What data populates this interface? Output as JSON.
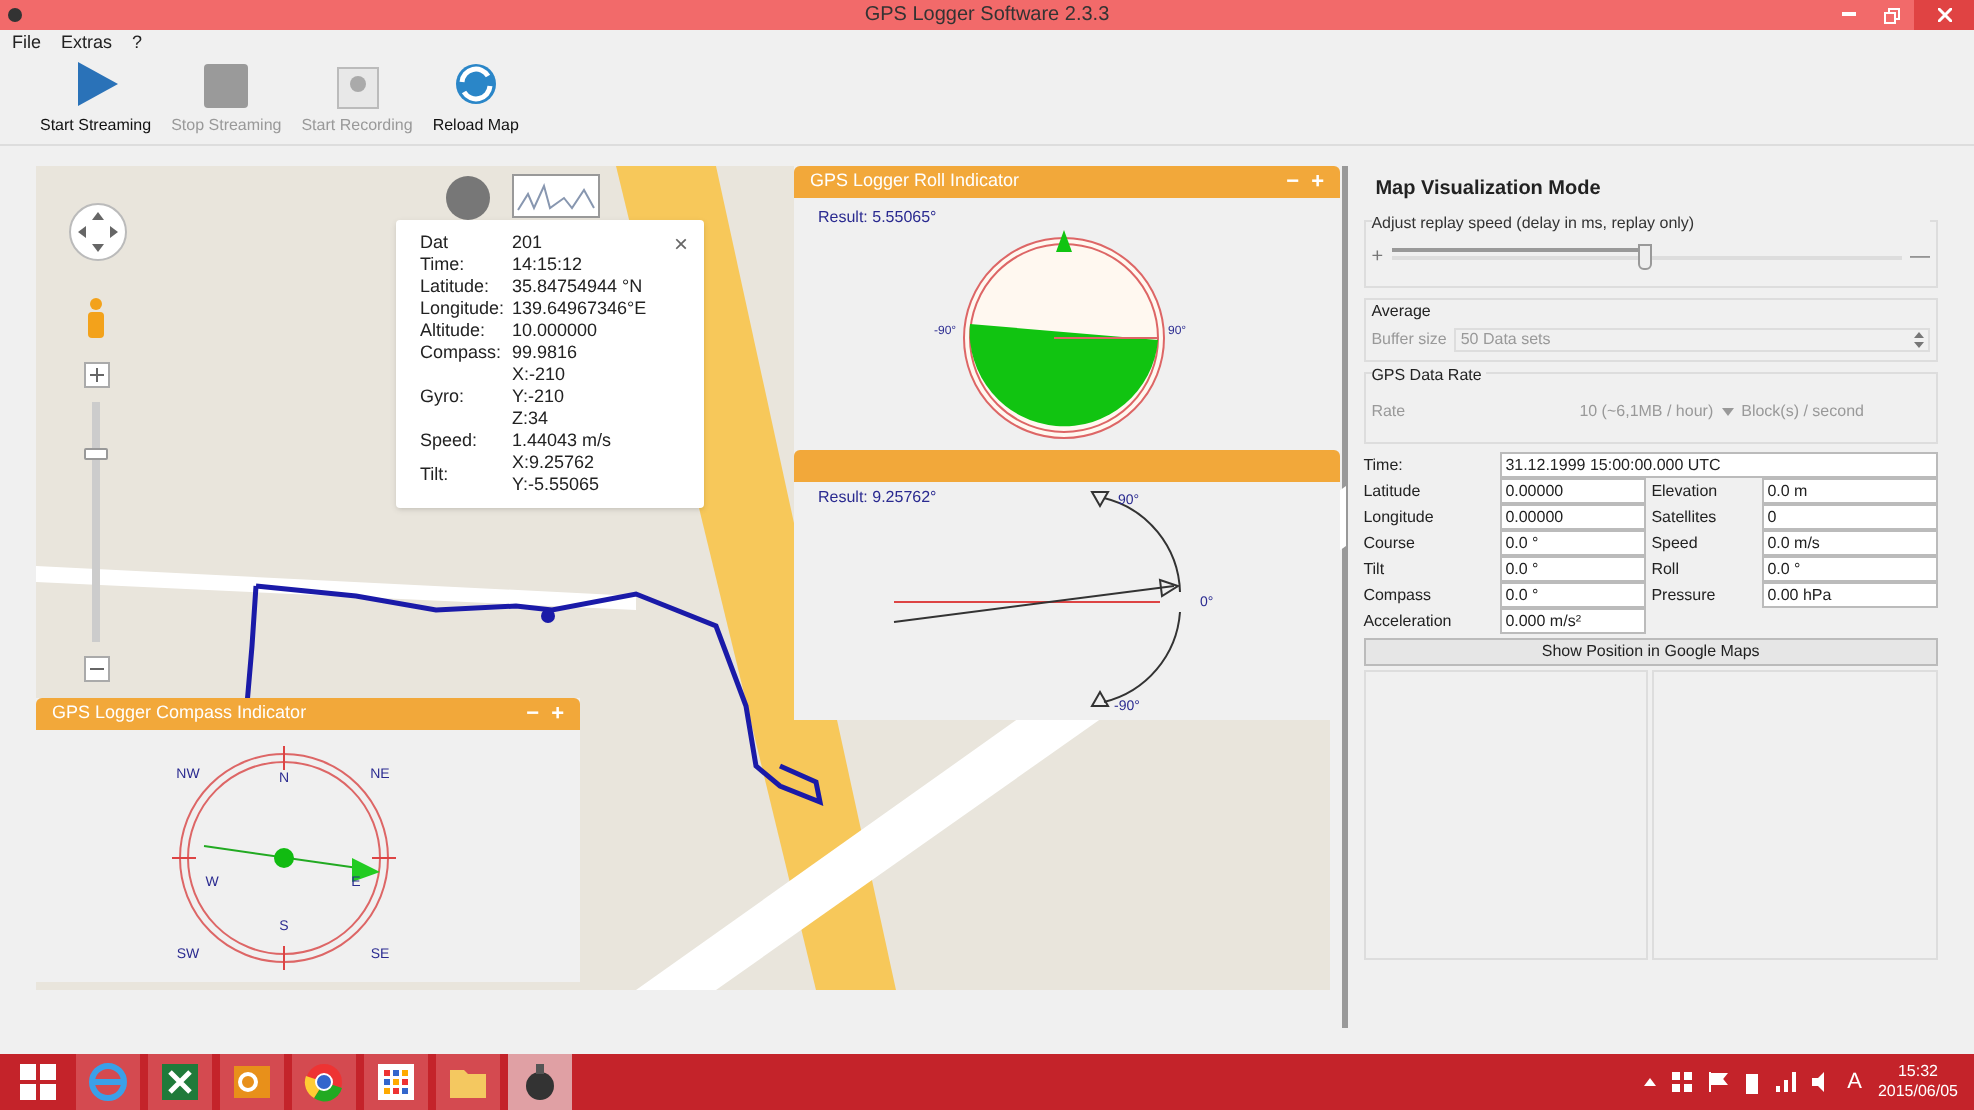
{
  "window": {
    "title": "GPS Logger Software 2.3.3"
  },
  "menu": [
    "File",
    "Extras",
    "?"
  ],
  "toolbar": [
    {
      "kind": "play",
      "label": "Start Streaming",
      "disabled": false
    },
    {
      "kind": "stop",
      "label": "Stop Streaming",
      "disabled": true
    },
    {
      "kind": "record",
      "label": "Start Recording",
      "disabled": true
    },
    {
      "kind": "reload",
      "label": "Reload Map",
      "disabled": false
    }
  ],
  "popup": {
    "rows": [
      {
        "label": "Dat",
        "lines": [
          "201"
        ]
      },
      {
        "label": "Time:",
        "lines": [
          "14:15:12"
        ]
      },
      {
        "label": "Latitude:",
        "lines": [
          "35.84754944 °N"
        ]
      },
      {
        "label": "Longitude:",
        "lines": [
          "139.64967346°E"
        ]
      },
      {
        "label": "Altitude:",
        "lines": [
          "10.000000"
        ]
      },
      {
        "label": "Compass:",
        "lines": [
          "99.9816"
        ]
      },
      {
        "label": "Gyro:",
        "lines": [
          "X:-210",
          "Y:-210",
          "Z:34"
        ]
      },
      {
        "label": "Speed:",
        "lines": [
          "1.44043 m/s"
        ]
      },
      {
        "label": "Tilt:",
        "lines": [
          "X:9.25762",
          "Y:-5.55065"
        ]
      }
    ],
    "close": "×"
  },
  "map_zoom": {
    "level": 0.8
  },
  "roll_panel": {
    "title": "GPS Logger Roll Indicator",
    "result": "Result: 5.55065°",
    "left": "-90°",
    "right": "90°",
    "buttons": [
      "−",
      "+"
    ]
  },
  "pitch_panel": {
    "result": "Result: 9.25762°",
    "top": "90°",
    "middle": "0°",
    "bottom": "-90°"
  },
  "compass_panel": {
    "title": "GPS Logger Compass Indicator",
    "buttons": [
      "−",
      "+"
    ],
    "directions": [
      "NW",
      "N",
      "NE",
      "W",
      "E",
      "SW",
      "S",
      "SE"
    ]
  },
  "side": {
    "title": "Map Visualization Mode",
    "replay": {
      "legend": "Adjust replay speed (delay in ms, replay only)",
      "plus": "+",
      "minus": "—",
      "level": 0.5
    },
    "average": {
      "legend": "Average",
      "label": "Buffer size",
      "value": "50 Data sets"
    },
    "rate": {
      "legend": "GPS Data Rate",
      "label": "Rate",
      "value": "10 (~6,1MB / hour)",
      "unit": "Block(s) / second"
    },
    "time": {
      "label": "Time:",
      "value": "31.12.1999 15:00:00.000 UTC"
    },
    "fields": [
      {
        "label": "Latitude",
        "value": "0.00000",
        "label2": "Elevation",
        "value2": "0.0 m"
      },
      {
        "label": "Longitude",
        "value": "0.00000",
        "label2": "Satellites",
        "value2": "0"
      },
      {
        "label": "Course",
        "value": "0.0 °",
        "label2": "Speed",
        "value2": "0.0 m/s"
      },
      {
        "label": "Tilt",
        "value": "0.0 °",
        "label2": "Roll",
        "value2": "0.0 °"
      },
      {
        "label": "Compass",
        "value": "0.0 °",
        "label2": "Pressure",
        "value2": "0.00 hPa"
      },
      {
        "label": "Acceleration",
        "value": "0.000 m/s²"
      }
    ],
    "button": "Show Position in Google Maps"
  },
  "taskbar": {
    "apps": [
      {
        "kind": "browser",
        "selected": false
      },
      {
        "kind": "spreadsheet",
        "selected": false
      },
      {
        "kind": "mail",
        "selected": false
      },
      {
        "kind": "chrome",
        "selected": false
      },
      {
        "kind": "apps",
        "selected": false
      },
      {
        "kind": "folder",
        "selected": false
      },
      {
        "kind": "logger",
        "selected": true
      }
    ],
    "ime": "A",
    "time": "15:32",
    "date": "2015/06/05"
  }
}
